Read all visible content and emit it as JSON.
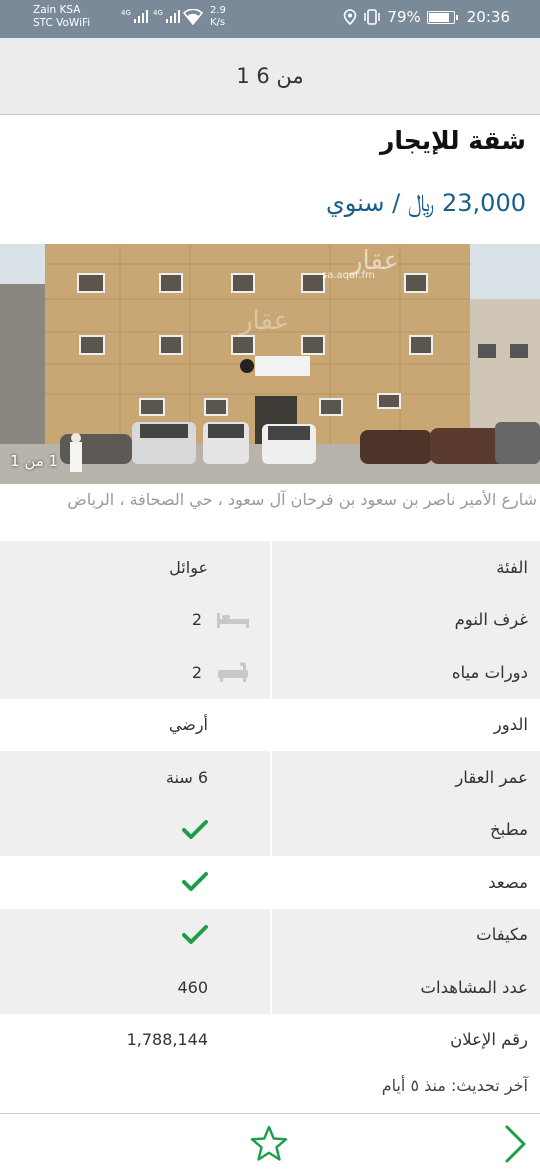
{
  "status_bar": {
    "carrier1": "Zain KSA",
    "carrier2": "STC VoWiFi",
    "volte_badge": "VoWiFi",
    "network1": "4G",
    "network2": "4G",
    "speed_value": "2.9",
    "speed_unit": "K/s",
    "battery": "79%",
    "time": "20:36"
  },
  "header": {
    "page_indicator": "1 من 6"
  },
  "listing": {
    "title": "شقة للإيجار",
    "price": "23,000 ﷼ / سنوي",
    "photo_counter": "1 من 1",
    "photo_watermark": "عقار",
    "photo_watermark_url": "sa.aqar.fm",
    "address": "شارع الأمير ناصر بن سعود بن فرحان آل سعود ، حي الصحافة ، الرياض"
  },
  "details": [
    {
      "label": "الفئة",
      "value": "عوائل",
      "icon": ""
    },
    {
      "label": "غرف النوم",
      "value": "2",
      "icon": "bed-icon"
    },
    {
      "label": "دورات مياه",
      "value": "2",
      "icon": "bathtub-icon"
    },
    {
      "label": "الدور",
      "value": "أرضي",
      "icon": ""
    },
    {
      "label": "عمر العقار",
      "value": "6 سنة",
      "icon": ""
    },
    {
      "label": "مطبخ",
      "value": "",
      "icon": "check-icon"
    },
    {
      "label": "مصعد",
      "value": "",
      "icon": "check-icon"
    },
    {
      "label": "مكيفات",
      "value": "",
      "icon": "check-icon"
    },
    {
      "label": "عدد المشاهدات",
      "value": "460",
      "icon": ""
    },
    {
      "label": "رقم الإعلان",
      "value": "1,788,144",
      "icon": ""
    }
  ],
  "last_update": "آخر تحديث: منذ ٥ أيام",
  "colors": {
    "accent": "#1a5f8c",
    "check": "#1e9e4a",
    "status_bar": "#7a8a99"
  }
}
